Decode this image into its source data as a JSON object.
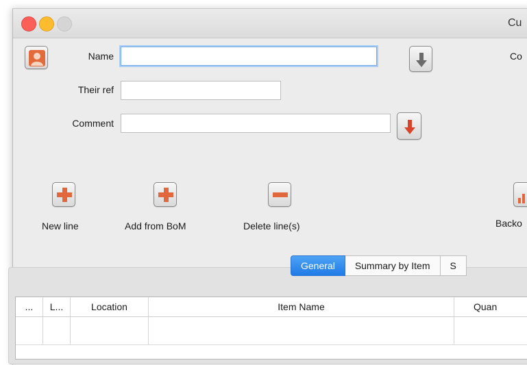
{
  "window": {
    "title": "Cu"
  },
  "form": {
    "name_label": "Name",
    "name_value": "",
    "right_label": "Co",
    "their_ref_label": "Their ref",
    "their_ref_value": "",
    "comment_label": "Comment",
    "comment_value": ""
  },
  "toolbar": {
    "new_line_label": "New line",
    "add_from_bom_label": "Add from BoM",
    "delete_lines_label": "Delete line(s)",
    "backorder_label": "Backo"
  },
  "tabs": [
    {
      "label": "General",
      "active": true
    },
    {
      "label": "Summary by Item",
      "active": false
    },
    {
      "label": "S",
      "active": false
    }
  ],
  "table": {
    "columns": [
      "...",
      "L...",
      "Location",
      "Item Name",
      "Quan"
    ]
  },
  "colors": {
    "accent_tab": "#2a83ea",
    "plus_icon": "#e0683c",
    "minus_icon": "#e0683c",
    "down_arrow_dark": "#6a6a6a",
    "down_arrow_red": "#d9452b"
  }
}
